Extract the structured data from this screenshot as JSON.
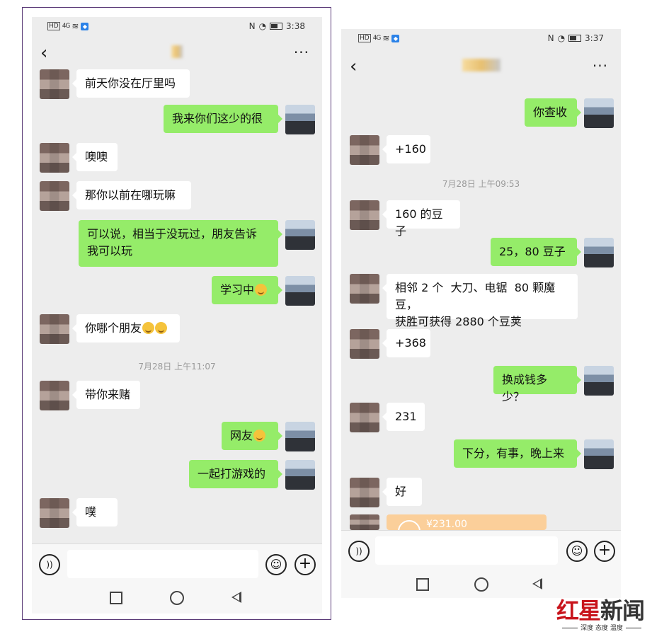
{
  "left": {
    "status": {
      "net": "4G",
      "time": "3:38"
    },
    "messages": [
      {
        "dir": "in",
        "text": "前天你没在厅里吗"
      },
      {
        "dir": "out",
        "text": "我来你们这少的很"
      },
      {
        "dir": "in",
        "text": "噢噢"
      },
      {
        "dir": "in",
        "text": "那你以前在哪玩嘛"
      },
      {
        "dir": "out",
        "text": "可以说，相当于没玩过，朋友告诉\n我可以玩"
      },
      {
        "dir": "out",
        "text": "学习中",
        "emoji": "laugh-emoji"
      },
      {
        "dir": "in",
        "text": "你哪个朋友",
        "emoji": "laugh-emoji"
      },
      {
        "dir": "in",
        "text": "带你来赌"
      },
      {
        "dir": "out",
        "text": "网友",
        "emoji": "shy-emoji"
      },
      {
        "dir": "out",
        "text": "一起打游戏的"
      },
      {
        "dir": "in",
        "text": "噗"
      }
    ],
    "timestamp": "7月28日 上午11:07"
  },
  "right": {
    "status": {
      "net": "4G",
      "time": "3:37"
    },
    "messages": [
      {
        "dir": "out",
        "text": "你查收"
      },
      {
        "dir": "in",
        "text": "+160"
      },
      {
        "dir": "in",
        "text": "160 的豆子"
      },
      {
        "dir": "out",
        "text": "25，80 豆子"
      },
      {
        "dir": "in",
        "text": "相邻 2 个  大刀、电锯  80 颗魔豆，\n获胜可获得 2880 个豆荚"
      },
      {
        "dir": "in",
        "text": "+368"
      },
      {
        "dir": "out",
        "text": "换成钱多少？"
      },
      {
        "dir": "in",
        "text": "231"
      },
      {
        "dir": "out",
        "text": "下分，有事，晚上来"
      },
      {
        "dir": "in",
        "text": "好"
      }
    ],
    "timestamp": "7月28日 上午09:53",
    "transfer_amount": "¥231.00"
  },
  "watermark": {
    "brand_red": "红星",
    "brand_dark": "新闻",
    "slogan": "深度 态度 温度"
  },
  "colors": {
    "bubble_out": "#95ec69",
    "bubble_in": "#ffffff",
    "chat_bg": "#ededed",
    "brand": "#c8141c"
  },
  "icons": [
    "back-icon",
    "more-icon",
    "voice-icon",
    "emoji-icon",
    "plus-icon",
    "square-nav-icon",
    "home-nav-icon",
    "back-nav-icon"
  ]
}
